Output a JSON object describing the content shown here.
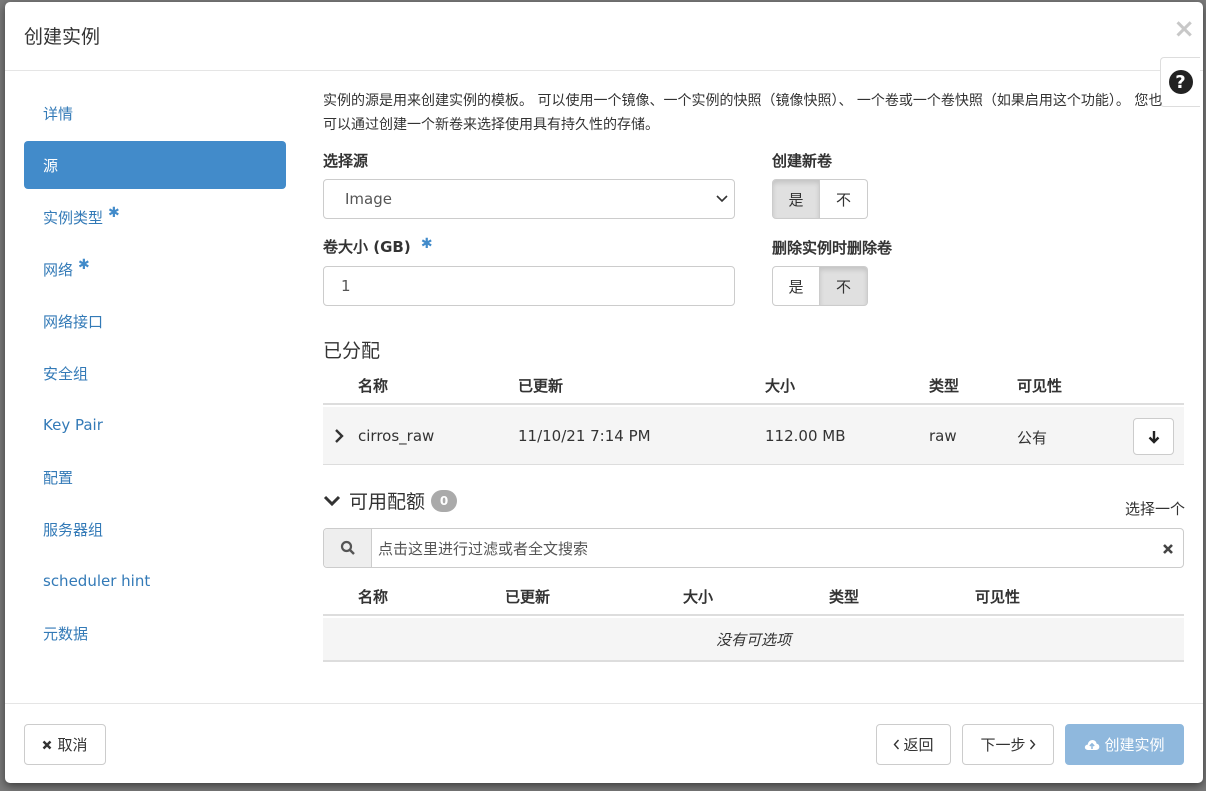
{
  "modal": {
    "title": "创建实例",
    "close_glyph": "×",
    "help_glyph": "?"
  },
  "sidebar": {
    "items": [
      {
        "label": "详情",
        "required": false,
        "active": false
      },
      {
        "label": "源",
        "required": false,
        "active": true
      },
      {
        "label": "实例类型",
        "required": true,
        "active": false
      },
      {
        "label": "网络",
        "required": true,
        "active": false
      },
      {
        "label": "网络接口",
        "required": false,
        "active": false
      },
      {
        "label": "安全组",
        "required": false,
        "active": false
      },
      {
        "label": "Key Pair",
        "required": false,
        "active": false
      },
      {
        "label": "配置",
        "required": false,
        "active": false
      },
      {
        "label": "服务器组",
        "required": false,
        "active": false
      },
      {
        "label": "scheduler hint",
        "required": false,
        "active": false
      },
      {
        "label": "元数据",
        "required": false,
        "active": false
      }
    ],
    "required_mark": "✱"
  },
  "source": {
    "intro": "实例的源是用来创建实例的模板。 可以使用一个镜像、一个实例的快照（镜像快照）、 一个卷或一个卷快照（如果启用这个功能）。 您也可以通过创建一个新卷来选择使用具有持久性的存储。",
    "select_source_label": "选择源",
    "select_source_value": "Image",
    "create_volume_label": "创建新卷",
    "create_volume_yes": "是",
    "create_volume_no": "不",
    "create_volume_selected": "yes",
    "volume_size_label": "卷大小 (GB)",
    "volume_size_value": "1",
    "delete_volume_label": "删除实例时删除卷",
    "delete_volume_yes": "是",
    "delete_volume_no": "不",
    "delete_volume_selected": "no"
  },
  "allocated": {
    "title": "已分配",
    "columns": [
      "名称",
      "已更新",
      "大小",
      "类型",
      "可见性"
    ],
    "rows": [
      {
        "name": "cirros_raw",
        "updated": "11/10/21 7:14 PM",
        "size": "112.00 MB",
        "type": "raw",
        "visibility": "公有"
      }
    ]
  },
  "available": {
    "title": "可用配额",
    "count": "0",
    "select_one": "选择一个",
    "search_placeholder": "点击这里进行过滤或者全文搜索",
    "columns": [
      "名称",
      "已更新",
      "大小",
      "类型",
      "可见性"
    ],
    "empty_text": "没有可选项"
  },
  "footer": {
    "cancel_label": "取消",
    "back_label": "返回",
    "next_label": "下一步",
    "create_label": "创建实例"
  },
  "colors": {
    "accent": "#428bca",
    "link": "#337ab7",
    "disabled_primary": "#8fb8dd"
  }
}
